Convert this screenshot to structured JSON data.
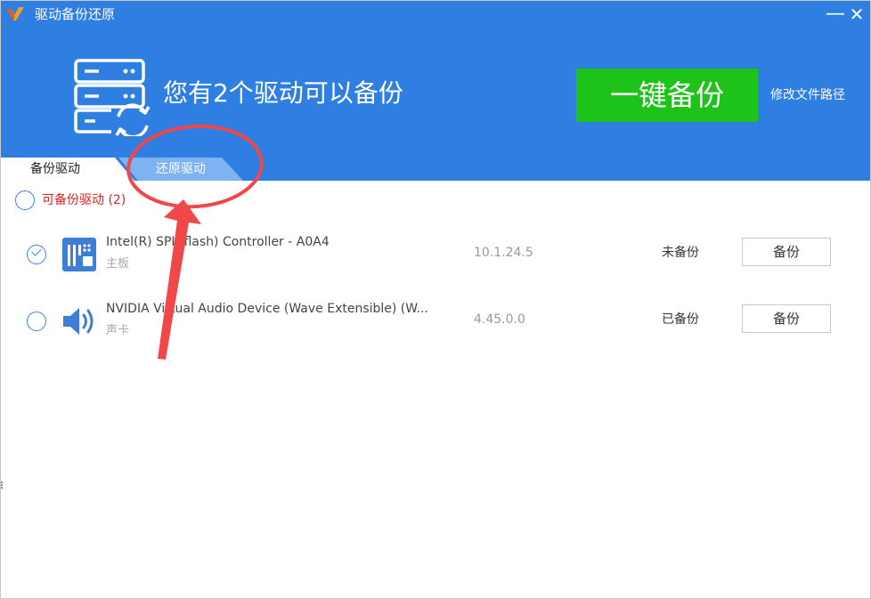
{
  "window": {
    "title": "驱动备份还原",
    "minimize_glyph": "—",
    "close_glyph": "✕"
  },
  "header": {
    "headline": "您有2个驱动可以备份",
    "backup_all_label": "一键备份",
    "change_path_label": "修改文件路径"
  },
  "tabs": [
    {
      "label": "备份驱动",
      "active": true
    },
    {
      "label": "还原驱动",
      "active": false
    }
  ],
  "group": {
    "label": "可备份驱动  (2)"
  },
  "drivers": [
    {
      "name": "Intel(R) SPI (flash) Controller - A0A4",
      "category": "主板",
      "version": "10.1.24.5",
      "status": "未备份",
      "button": "备份",
      "checked": true,
      "icon": "chip-icon"
    },
    {
      "name": "NVIDIA Virtual Audio Device (Wave Extensible) (W...",
      "category": "声卡",
      "version": "4.45.0.0",
      "status": "已备份",
      "button": "备份",
      "checked": false,
      "icon": "speaker-icon"
    }
  ],
  "colors": {
    "header_blue": "#2f7ee2",
    "button_green": "#1ec31a",
    "inactive_tab": "#7fb2f0",
    "group_red": "#e02020",
    "annotation_red": "#f04848"
  }
}
